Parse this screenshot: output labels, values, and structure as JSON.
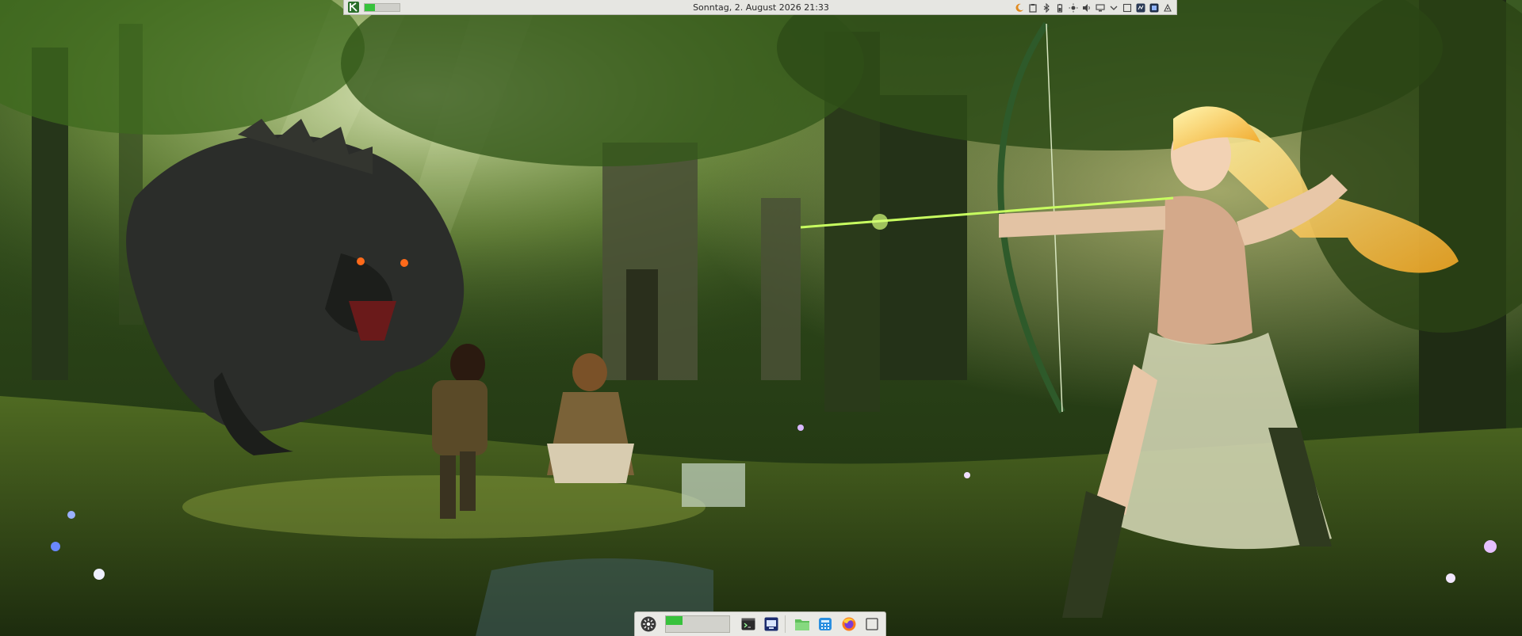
{
  "topbar": {
    "clock": "Sonntag, 2. August 2026 21:33",
    "cpu_usage_fraction": 0.3,
    "accent": "#37c23c",
    "tray_icons": [
      "night-mode-icon",
      "clipboard-icon",
      "bluetooth-icon",
      "battery-icon",
      "brightness-icon",
      "volume-icon",
      "network-icon",
      "expand-tray-icon",
      "window-icon",
      "app-tray-icon-1",
      "app-tray-icon-2",
      "app-tray-icon-3"
    ]
  },
  "dock": {
    "memory_usage_fraction": 0.27,
    "items": [
      "app-menu-icon",
      "terminal-icon",
      "blue-app-icon",
      "file-manager-icon",
      "calculator-icon",
      "firefox-icon",
      "show-desktop-icon"
    ]
  },
  "wallpaper": {
    "description_colors": {
      "canopy": "#2d4a1a",
      "light": "#e8f5a0",
      "ground": "#3d5520"
    }
  }
}
